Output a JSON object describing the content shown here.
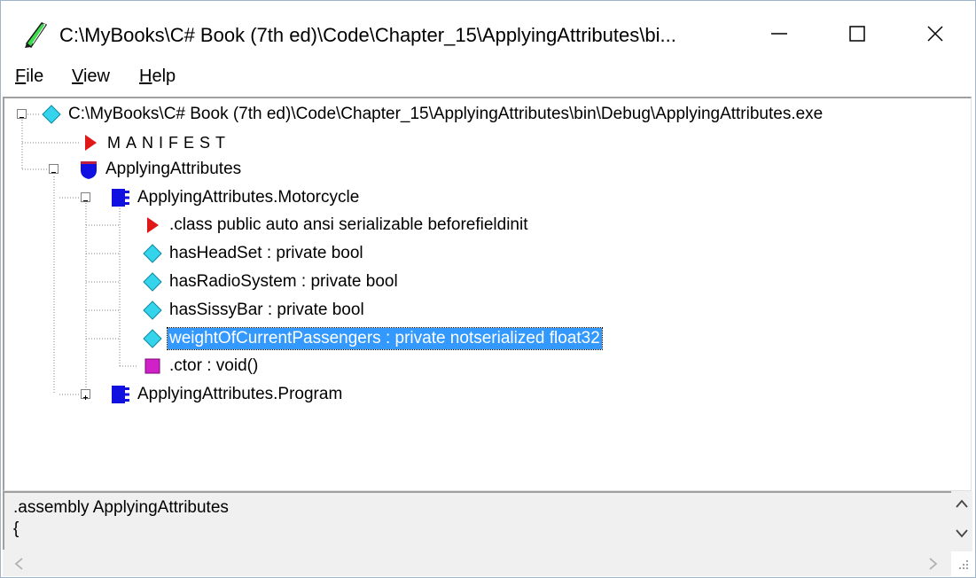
{
  "window": {
    "title": "C:\\MyBooks\\C# Book (7th ed)\\Code\\Chapter_15\\ApplyingAttributes\\bi...",
    "minimize_label": "—",
    "maximize_label": "☐",
    "close_label": "✕"
  },
  "menu": {
    "file": {
      "mnemonic": "F",
      "rest": "ile"
    },
    "view": {
      "mnemonic": "V",
      "rest": "iew"
    },
    "help": {
      "mnemonic": "H",
      "rest": "elp"
    }
  },
  "tree": {
    "root": {
      "label": "C:\\MyBooks\\C# Book (7th ed)\\Code\\Chapter_15\\ApplyingAttributes\\bin\\Debug\\ApplyingAttributes.exe",
      "icon": "diamond-cyan-icon"
    },
    "manifest": {
      "label": "MANIFEST",
      "icon": "triangle-red-icon"
    },
    "namespace": {
      "label": "ApplyingAttributes",
      "icon": "namespace-shield-icon"
    },
    "class_motorcycle": {
      "label": "ApplyingAttributes.Motorcycle",
      "icon": "class-icon"
    },
    "class_directive": {
      "label": ".class public auto ansi serializable beforefieldinit",
      "icon": "triangle-red-icon"
    },
    "field_headset": {
      "label": "hasHeadSet : private bool",
      "icon": "field-diamond-icon"
    },
    "field_radio": {
      "label": "hasRadioSystem : private bool",
      "icon": "field-diamond-icon"
    },
    "field_sissybar": {
      "label": "hasSissyBar : private bool",
      "icon": "field-diamond-icon"
    },
    "field_weight": {
      "label": "weightOfCurrentPassengers : private notserialized float32",
      "icon": "field-diamond-icon",
      "selected": true
    },
    "ctor": {
      "label": ".ctor : void()",
      "icon": "method-square-icon"
    },
    "class_program": {
      "label": "ApplyingAttributes.Program",
      "icon": "class-icon"
    }
  },
  "il_pane": {
    "line1": ".assembly ApplyingAttributes",
    "line2": "{"
  },
  "colors": {
    "selection": "#3399ff",
    "diamond": "#35d4ec",
    "triangle": "#e01818",
    "class_blue": "#1010e0",
    "method_magenta": "#d020c8"
  }
}
